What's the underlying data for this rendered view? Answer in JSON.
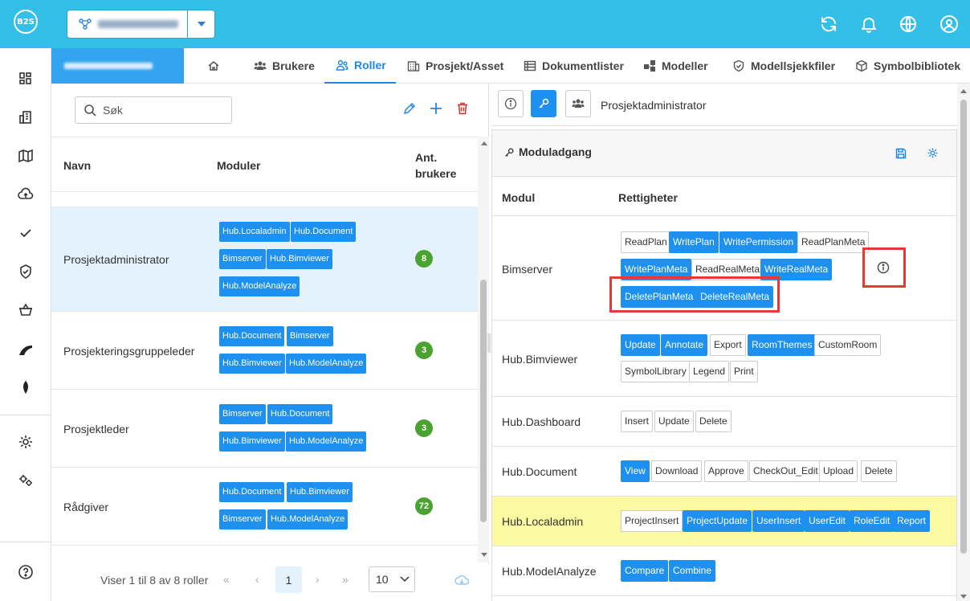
{
  "logo": "B2S",
  "topbar": {
    "project_placeholder_blurred": true
  },
  "sidebar": {
    "icons": [
      "dashboard-icon",
      "building-icon",
      "map-icon",
      "upload-icon",
      "check-icon",
      "shield-check-icon",
      "basket-icon",
      "brand-swoosh-icon",
      "leaf-icon",
      "settings-icon",
      "gears-icon",
      "help-icon"
    ]
  },
  "tabs": [
    {
      "label": "",
      "icon": "home-icon"
    },
    {
      "label": "Brukere",
      "icon": "users-icon"
    },
    {
      "label": "Roller",
      "icon": "user-roles-icon",
      "active": true
    },
    {
      "label": "Prosjekt/Asset",
      "icon": "building-icon"
    },
    {
      "label": "Dokumentlister",
      "icon": "list-icon"
    },
    {
      "label": "Modeller",
      "icon": "models-icon"
    },
    {
      "label": "Modellsjekkfiler",
      "icon": "shield-icon"
    },
    {
      "label": "Symbolbibliotek",
      "icon": "cube-icon"
    }
  ],
  "roles": {
    "search_placeholder": "Søk",
    "columns": {
      "name": "Navn",
      "modules": "Moduler",
      "count_line1": "Ant.",
      "count_line2": "brukere"
    },
    "rows": [
      {
        "name": "Prosjektadministrator",
        "count": "8",
        "modules": [
          "Hub.Localadmin",
          "Hub.Document",
          "Bimserver",
          "Hub.Bimviewer",
          "Hub.ModelAnalyze"
        ],
        "selected": true
      },
      {
        "name": "Prosjekteringsgruppeleder",
        "count": "3",
        "modules": [
          "Hub.Document",
          "Bimserver",
          "Hub.Bimviewer",
          "Hub.ModelAnalyze"
        ]
      },
      {
        "name": "Prosjektleder",
        "count": "3",
        "modules": [
          "Bimserver",
          "Hub.Document",
          "Hub.Bimviewer",
          "Hub.ModelAnalyze"
        ]
      },
      {
        "name": "Rådgiver",
        "count": "72",
        "modules": [
          "Hub.Document",
          "Hub.Bimviewer",
          "Bimserver",
          "Hub.ModelAnalyze"
        ]
      }
    ],
    "pager": {
      "info": "Viser 1 til 8 av 8 roller",
      "page": "1",
      "page_size": "10"
    }
  },
  "detail": {
    "role_title": "Prosjektadministrator",
    "section_title": "Moduladgang",
    "columns": {
      "module": "Modul",
      "rights": "Rettigheter"
    },
    "modules": [
      {
        "name": "Bimserver",
        "perms": [
          {
            "label": "ReadPlan",
            "on": false
          },
          {
            "label": "WritePlan",
            "on": true
          },
          {
            "label": "WritePermission",
            "on": true
          },
          {
            "label": "ReadPlanMeta",
            "on": false
          },
          {
            "label": "WritePlanMeta",
            "on": true
          },
          {
            "label": "ReadRealMeta",
            "on": false
          },
          {
            "label": "WriteRealMeta",
            "on": true
          },
          {
            "label": "DeletePlanMeta",
            "on": true
          },
          {
            "label": "DeleteRealMeta",
            "on": true
          }
        ]
      },
      {
        "name": "Hub.Bimviewer",
        "perms": [
          {
            "label": "Update",
            "on": true
          },
          {
            "label": "Annotate",
            "on": true
          },
          {
            "label": "Export",
            "on": false
          },
          {
            "label": "RoomThemes",
            "on": true
          },
          {
            "label": "CustomRoom",
            "on": false
          },
          {
            "label": "SymbolLibrary",
            "on": false
          },
          {
            "label": "Legend",
            "on": false
          },
          {
            "label": "Print",
            "on": false
          }
        ]
      },
      {
        "name": "Hub.Dashboard",
        "perms": [
          {
            "label": "Insert",
            "on": false
          },
          {
            "label": "Update",
            "on": false
          },
          {
            "label": "Delete",
            "on": false
          }
        ]
      },
      {
        "name": "Hub.Document",
        "perms": [
          {
            "label": "View",
            "on": true
          },
          {
            "label": "Download",
            "on": false
          },
          {
            "label": "Approve",
            "on": false
          },
          {
            "label": "CheckOut_Edit",
            "on": false
          },
          {
            "label": "Upload",
            "on": false
          },
          {
            "label": "Delete",
            "on": false
          }
        ]
      },
      {
        "name": "Hub.Localadmin",
        "highlight": true,
        "perms": [
          {
            "label": "ProjectInsert",
            "on": false
          },
          {
            "label": "ProjectUpdate",
            "on": true
          },
          {
            "label": "UserInsert",
            "on": true
          },
          {
            "label": "UserEdit",
            "on": true
          },
          {
            "label": "RoleEdit",
            "on": true
          },
          {
            "label": "Report",
            "on": true
          }
        ]
      },
      {
        "name": "Hub.ModelAnalyze",
        "perms": [
          {
            "label": "Compare",
            "on": true
          },
          {
            "label": "Combine",
            "on": true
          }
        ]
      }
    ]
  },
  "colors": {
    "topbar": "#33bfe8",
    "accent": "#1e90f0",
    "count_badge": "#4aa330",
    "highlight_row": "#fbf9a2",
    "annotation": "#e53935"
  }
}
